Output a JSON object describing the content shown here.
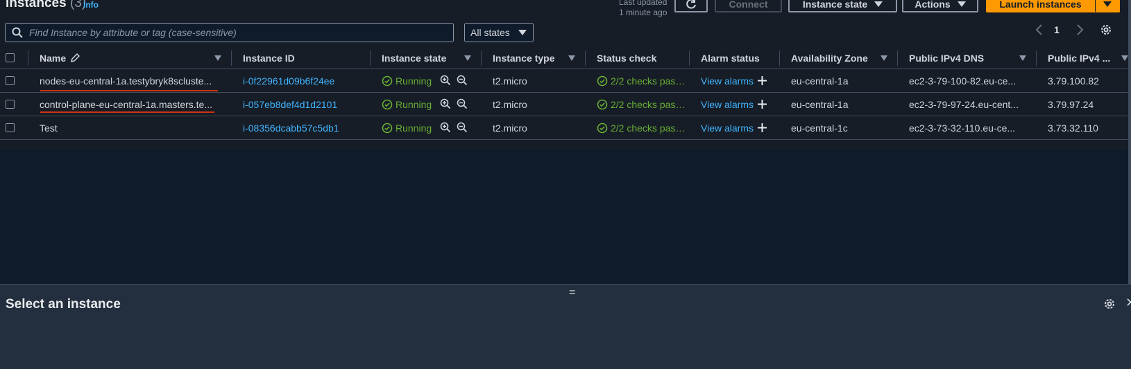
{
  "header": {
    "title": "Instances",
    "count": "(3)",
    "info": "Info",
    "last_updated_line1": "Last updated",
    "last_updated_line2": "1 minute ago",
    "connect": "Connect",
    "instance_state": "Instance state",
    "actions": "Actions",
    "launch": "Launch instances"
  },
  "filter": {
    "placeholder": "Find Instance by attribute or tag (case-sensitive)",
    "state_select": "All states"
  },
  "pagination": {
    "page": "1"
  },
  "columns": [
    "Name",
    "Instance ID",
    "Instance state",
    "Instance type",
    "Status check",
    "Alarm status",
    "Availability Zone",
    "Public IPv4 DNS",
    "Public IPv4 ..."
  ],
  "rows": [
    {
      "name": "nodes-eu-central-1a.testybryk8scluste...",
      "id": "i-0f22961d09b6f24ee",
      "state": "Running",
      "type": "t2.micro",
      "status": "2/2 checks passec",
      "alarm": "View alarms",
      "az": "eu-central-1a",
      "dns": "ec2-3-79-100-82.eu-ce...",
      "ip": "3.79.100.82"
    },
    {
      "name": "control-plane-eu-central-1a.masters.te...",
      "id": "i-057eb8def4d1d2101",
      "state": "Running",
      "type": "t2.micro",
      "status": "2/2 checks passec",
      "alarm": "View alarms",
      "az": "eu-central-1a",
      "dns": "ec2-3-79-97-24.eu-cent...",
      "ip": "3.79.97.24"
    },
    {
      "name": "Test",
      "id": "i-08356dcabb57c5db1",
      "state": "Running",
      "type": "t2.micro",
      "status": "2/2 checks passec",
      "alarm": "View alarms",
      "az": "eu-central-1c",
      "dns": "ec2-3-73-32-110.eu-ce...",
      "ip": "3.73.32.110"
    }
  ],
  "detail": {
    "handle": "=",
    "title": "Select an instance"
  },
  "colors": {
    "accent": "#ff9900",
    "link": "#42b4ff",
    "success": "#6aaf35",
    "annotation": "#d13212"
  }
}
